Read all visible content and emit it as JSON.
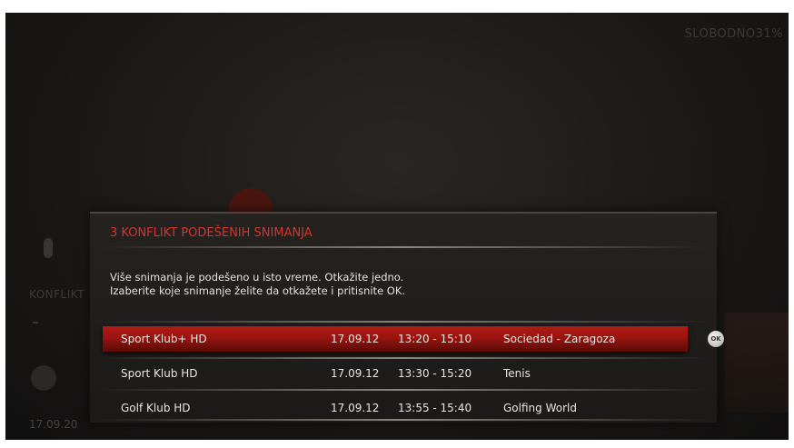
{
  "background": {
    "free_space": "SLOBODNO31%",
    "left_label": "KONFLIKT",
    "left_date": "17.09.20"
  },
  "dialog": {
    "title": "3 KONFLIKT PODEŠENIH SNIMANJA",
    "message_line1": "Više snimanja je podešeno u isto vreme. Otkažite jedno.",
    "message_line2": "Izaberite koje snimanje želite da otkažete i pritisnite OK.",
    "ok_label": "OK",
    "rows": [
      {
        "channel": "Sport Klub+ HD",
        "date": "17.09.12",
        "time": "13:20 - 15:10",
        "program": "Sociedad - Zaragoza",
        "selected": true
      },
      {
        "channel": "Sport Klub HD",
        "date": "17.09.12",
        "time": "13:30 - 15:20",
        "program": "Tenis",
        "selected": false
      },
      {
        "channel": "Golf Klub HD",
        "date": "17.09.12",
        "time": "13:55 - 15:40",
        "program": "Golfing World",
        "selected": false
      }
    ]
  },
  "colors": {
    "accent_red": "#d8332a",
    "selection_red": "#b31a14",
    "background": "#1b1917"
  }
}
